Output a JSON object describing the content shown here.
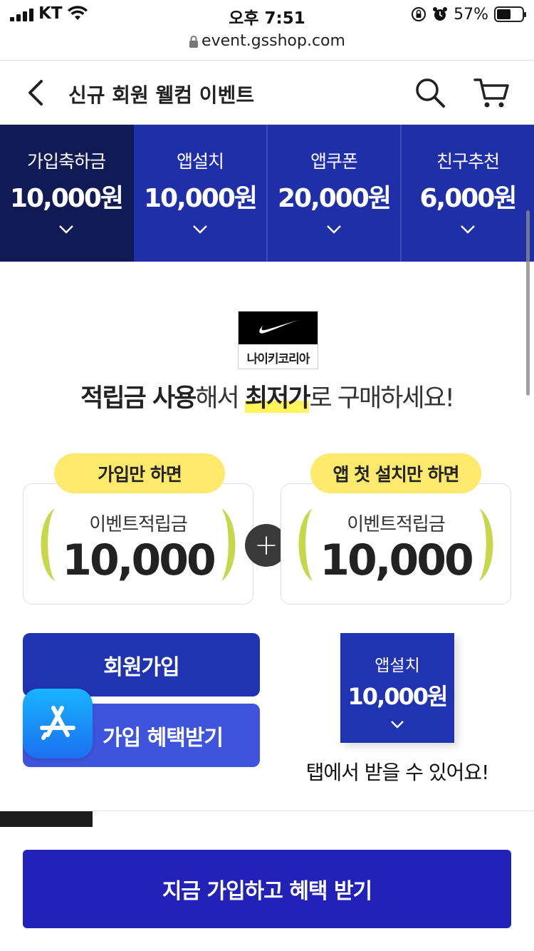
{
  "status_bar": {
    "carrier": "KT",
    "time": "오후 7:51",
    "battery_percent": "57%",
    "battery_level": 0.57
  },
  "browser": {
    "url": "event.gsshop.com"
  },
  "nav": {
    "title": "신규 회원 웰컴 이벤트",
    "icons": [
      "back-icon",
      "search-icon",
      "cart-icon"
    ]
  },
  "tabs": [
    {
      "label": "가입축하금",
      "amount": "10,000원",
      "active": true
    },
    {
      "label": "앱설치",
      "amount": "10,000원",
      "active": false
    },
    {
      "label": "앱쿠폰",
      "amount": "20,000원",
      "active": false
    },
    {
      "label": "친구추천",
      "amount": "6,000원",
      "active": false
    }
  ],
  "brand": {
    "name": "나이키코리아",
    "logo": "swoosh-logo"
  },
  "headline": {
    "part1": "적립금 사용",
    "part2": "해서 ",
    "part3": "최저가",
    "part4": "로 구매하세요!"
  },
  "rewards": [
    {
      "pill": "가입만 하면",
      "label": "이벤트적립금",
      "amount": "10,000"
    },
    {
      "pill": "앱 첫 설치만 하면",
      "label": "이벤트적립금",
      "amount": "10,000"
    }
  ],
  "buttons": {
    "join": "회원가입",
    "benefit": "가입 혜택받기",
    "cta": "지금 가입하고 혜택 받기"
  },
  "app_install": {
    "label": "앱설치",
    "amount": "10,000원",
    "note": "탭에서 받을 수 있어요!"
  },
  "colors": {
    "primary": "#2034b2",
    "tab_active": "#101a55",
    "highlight": "#fff45a",
    "pill": "#fde96c",
    "paren": "#c5d84a",
    "cta": "#2322b8"
  }
}
